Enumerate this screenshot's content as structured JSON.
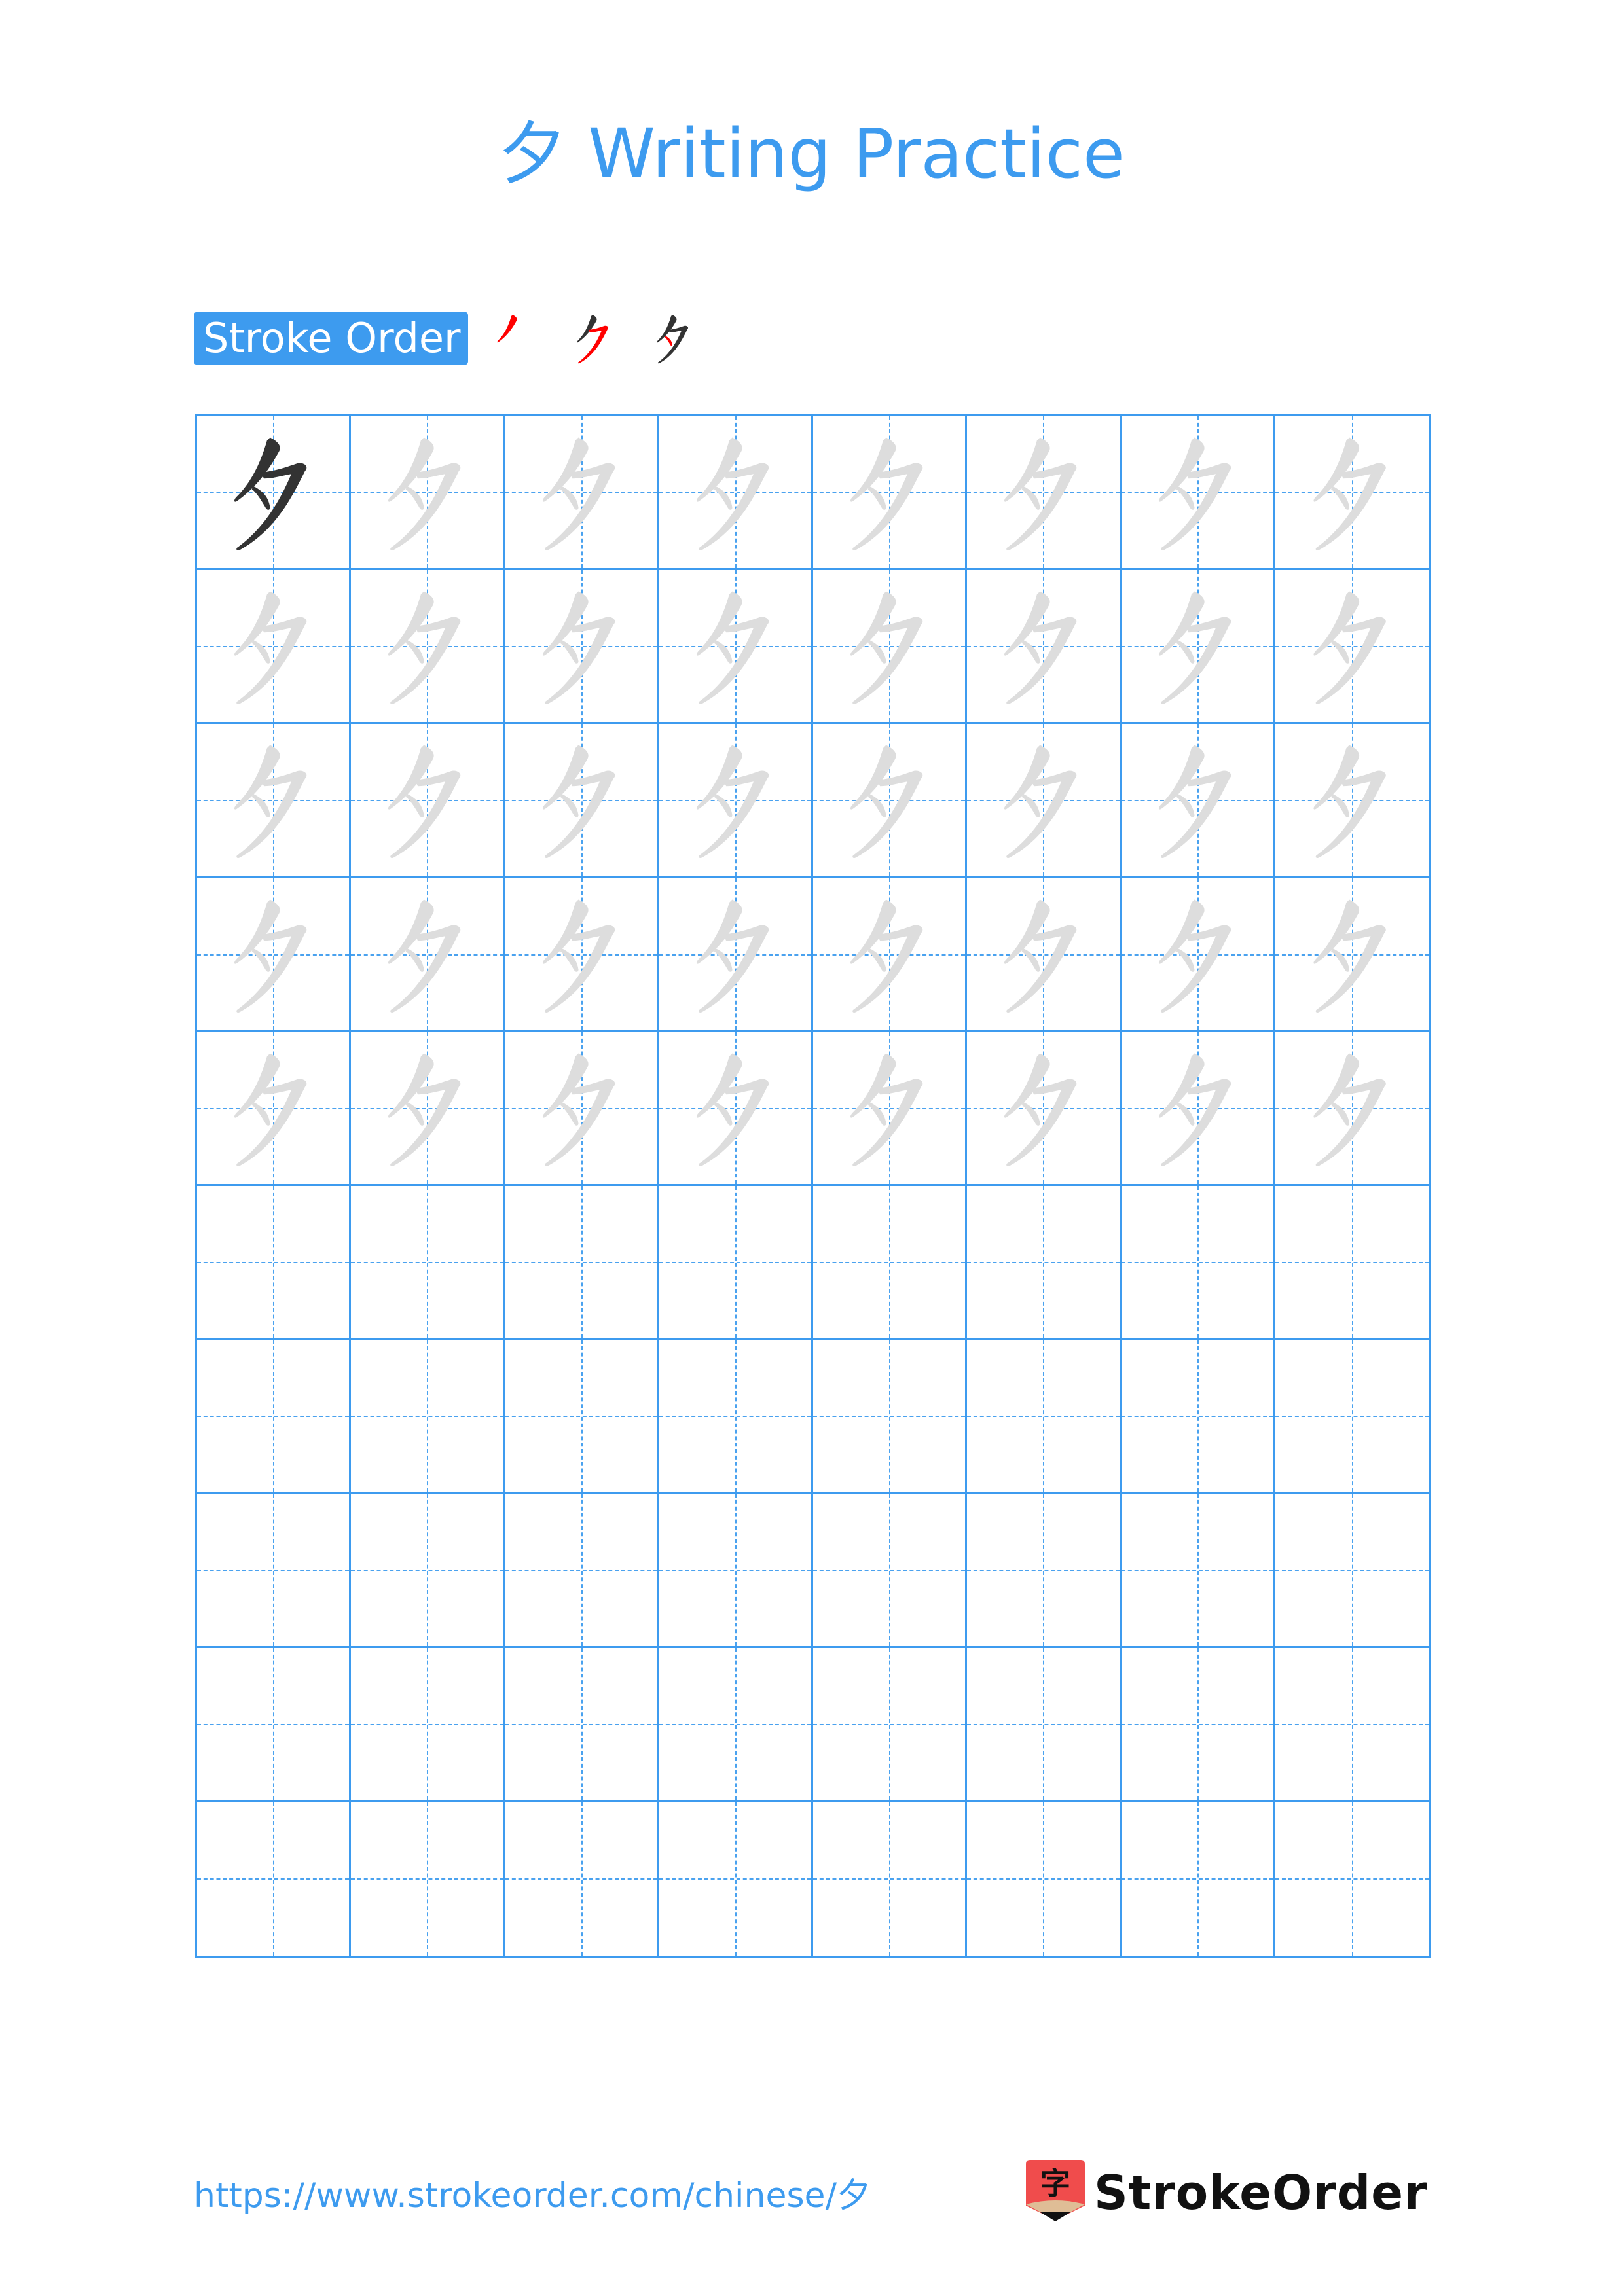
{
  "page": {
    "title": "夕 Writing Practice",
    "character": "夕"
  },
  "stroke_order": {
    "label": "Stroke Order",
    "step_count": 3,
    "colors": {
      "active": "#ff0000",
      "done": "#333333"
    }
  },
  "grid": {
    "columns": 8,
    "rows": 10,
    "model_rows": 1,
    "trace_rows": 5,
    "colors": {
      "line": "#3d9bef",
      "model": "#333333",
      "trace": "#dddddd"
    }
  },
  "footer": {
    "url": "https://www.strokeorder.com/chinese/夕",
    "brand": "StrokeOrder",
    "logo_glyph": "字"
  },
  "colors": {
    "accent": "#3d9bef",
    "logo_red": "#f04c4c",
    "logo_tan": "#dfbd96"
  }
}
